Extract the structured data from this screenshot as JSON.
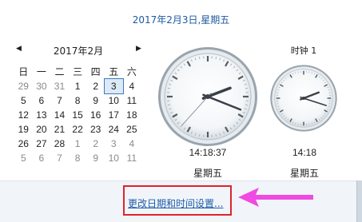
{
  "header": {
    "date_text": "2017年2月3日,星期五"
  },
  "calendar": {
    "month_label": "2017年2月",
    "prev_icon": "triangle-left-icon",
    "next_icon": "triangle-right-icon",
    "weekdays": [
      "日",
      "一",
      "二",
      "三",
      "四",
      "五",
      "六"
    ],
    "weeks": [
      [
        "29",
        "30",
        "31",
        "1",
        "2",
        "3",
        "4"
      ],
      [
        "5",
        "6",
        "7",
        "8",
        "9",
        "10",
        "11"
      ],
      [
        "12",
        "13",
        "14",
        "15",
        "16",
        "17",
        "18"
      ],
      [
        "19",
        "20",
        "21",
        "22",
        "23",
        "24",
        "25"
      ],
      [
        "26",
        "27",
        "28",
        "1",
        "2",
        "3",
        "4"
      ],
      [
        "5",
        "6",
        "7",
        "8",
        "9",
        "10",
        "11"
      ]
    ],
    "today": "3"
  },
  "clocks": [
    {
      "label": "",
      "time": "14:18:37",
      "day": "星期五",
      "hour": 14,
      "minute": 18,
      "second": 37
    },
    {
      "label": "时钟 1",
      "time": "14:18",
      "day": "星期五",
      "hour": 14,
      "minute": 18,
      "second": null
    }
  ],
  "footer": {
    "link_label": "更改日期和时间设置..."
  },
  "annotation": {
    "highlight_color": "#e1232a",
    "arrow_color": "#f04ae3"
  }
}
